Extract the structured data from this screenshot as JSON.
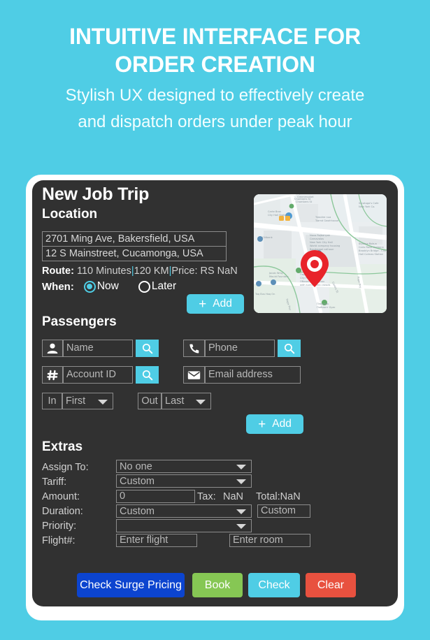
{
  "theme": {
    "background": "#4fcde5",
    "card": "#313131",
    "frame": "#ffffff",
    "accent": "#4fcde5"
  },
  "header": {
    "title": "INTUITIVE INTERFACE FOR ORDER CREATION",
    "subtitle": "Stylish UX designed to effectively create and dispatch orders under peak hour"
  },
  "card": {
    "title": "New Job Trip",
    "location": {
      "heading": "Location",
      "pickup_value": "2701 Ming Ave, Bakersfield, USA",
      "dropoff_value": "12 S Mainstreet, Cucamonga, USA",
      "route_label": "Route:",
      "route_duration": "110 Minutes",
      "route_distance": "120 KM",
      "route_price": "Price: RS NaN",
      "when_label": "When:",
      "when_now": "Now",
      "when_later": "Later",
      "when_selected": "Now",
      "add_label": "Add",
      "map_icon": "map-thumbnail",
      "pin_icon": "map-pin-icon"
    },
    "passengers": {
      "heading": "Passengers",
      "name_icon": "person-icon",
      "name_placeholder": "Name",
      "name_search_icon": "search-icon",
      "phone_icon": "phone-icon",
      "phone_placeholder": "Phone",
      "phone_search_icon": "search-icon",
      "account_icon": "hash-icon",
      "account_placeholder": "Account ID",
      "account_search_icon": "search-icon",
      "email_icon": "envelope-icon",
      "email_placeholder": "Email address",
      "in_label": "In",
      "in_value": "First",
      "out_label": "Out",
      "out_value": "Last",
      "add_label": "Add"
    },
    "extras": {
      "heading": "Extras",
      "assign_label": "Assign To:",
      "assign_value": "No one",
      "tariff_label": "Tariff:",
      "tariff_value": "Custom",
      "amount_label": "Amount:",
      "amount_value": "0",
      "tax_label": "Tax:",
      "tax_value": "NaN",
      "total_text": "Total:NaN",
      "duration_label": "Duration:",
      "duration_value": "Custom",
      "duration_extra_value": "Custom",
      "priority_label": "Priority:",
      "priority_value": "",
      "flight_label": "Flight#:",
      "flight_placeholder": "Enter flight",
      "room_placeholder": "Enter room"
    },
    "actions": {
      "surge_label": "Check Surge Pricing",
      "surge_color": "#0c44cf",
      "book_label": "Book",
      "book_color": "#86c754",
      "check_label": "Check",
      "check_color": "#4fcde5",
      "clear_label": "Clear",
      "clear_color": "#e8513f"
    }
  }
}
